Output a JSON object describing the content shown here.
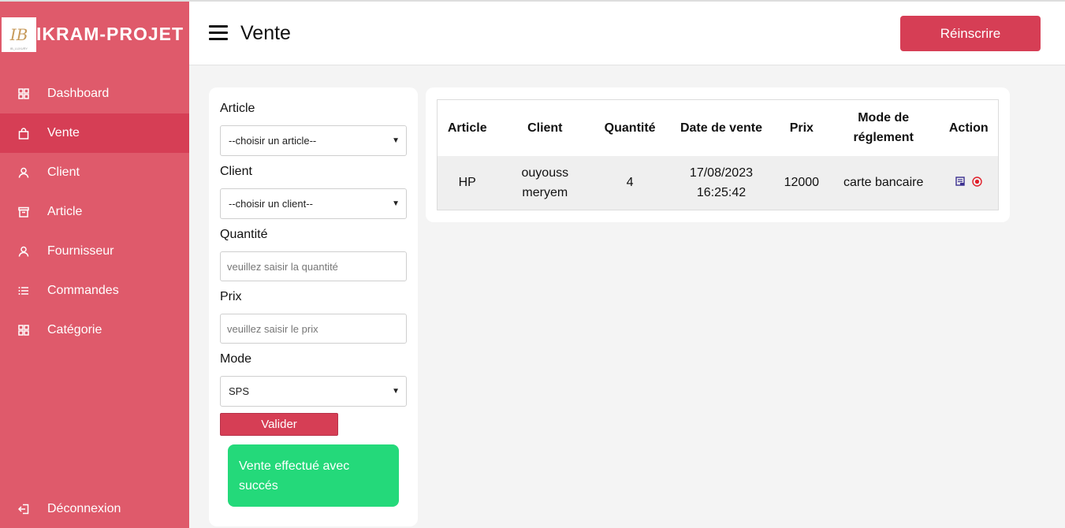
{
  "brand": {
    "title": "IKRAM-PROJET",
    "logo_text": "IB",
    "logo_sub": "IB_LUXURY"
  },
  "sidebar": {
    "items": [
      {
        "label": "Dashboard",
        "icon": "grid-icon"
      },
      {
        "label": "Vente",
        "icon": "bag-icon",
        "active": true
      },
      {
        "label": "Client",
        "icon": "user-icon"
      },
      {
        "label": "Article",
        "icon": "archive-icon"
      },
      {
        "label": "Fournisseur",
        "icon": "user-icon"
      },
      {
        "label": "Commandes",
        "icon": "list-icon"
      },
      {
        "label": "Catégorie",
        "icon": "grid-icon"
      }
    ],
    "logout_label": "Déconnexion"
  },
  "header": {
    "title": "Vente",
    "button_label": "Réinscrire"
  },
  "form": {
    "article_label": "Article",
    "article_select": "--choisir un article--",
    "client_label": "Client",
    "client_select": "--choisir un client--",
    "quantite_label": "Quantité",
    "quantite_placeholder": "veuillez saisir la quantité",
    "prix_label": "Prix",
    "prix_placeholder": "veuillez saisir le prix",
    "mode_label": "Mode",
    "mode_select": "SPS",
    "submit_label": "Valider",
    "success_message": "Vente effectué avec succés"
  },
  "table": {
    "headers": [
      "Article",
      "Client",
      "Quantité",
      "Date de vente",
      "Prix",
      "Mode de réglement",
      "Action"
    ],
    "rows": [
      {
        "article": "HP",
        "client": "ouyouss meryem",
        "quantite": "4",
        "date": "17/08/2023 16:25:42",
        "prix": "12000",
        "mode": "carte bancaire"
      }
    ]
  },
  "colors": {
    "sidebar": "#df5a6b",
    "accent": "#d63e55",
    "success": "#24d97a"
  }
}
